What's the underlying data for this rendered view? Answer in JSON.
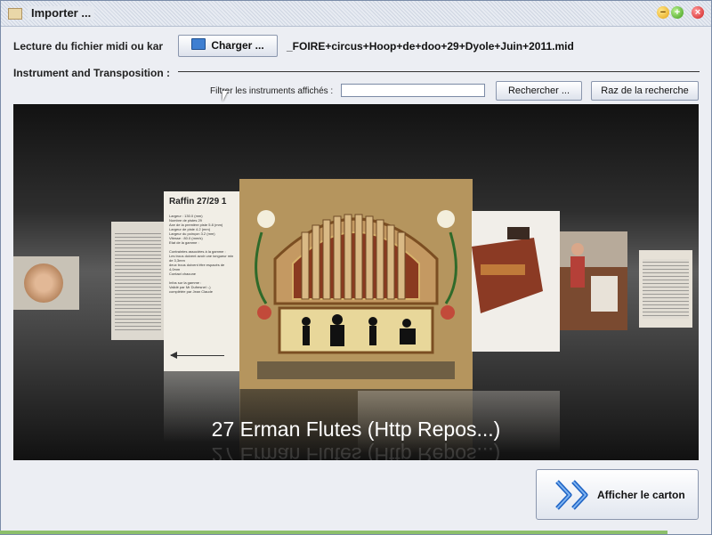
{
  "window": {
    "title": "Importer ..."
  },
  "file": {
    "label": "Lecture du fichier midi ou kar",
    "load_button": "Charger ...",
    "filename": "_FOIRE+circus+Hoop+de+doo+29+Dyole+Juin+2011.mid"
  },
  "section": {
    "label": "Instrument and Transposition :"
  },
  "filter": {
    "label": "Filtrer les instruments affichés :",
    "value": "",
    "search_button": "Rechercher ...",
    "reset_button": "Raz de la recherche"
  },
  "coverflow": {
    "selected_caption": "27 Erman Flutes (Http Repos...)",
    "raffin_card": {
      "title": "Raffin 27/29 1",
      "text": "Largeur : 130.0 (mm)\nNombre de pistes 29\nAxe de la première piste 5.8 (mm)\nLargeur de piste 4.2 (mm)\nLargeur du poinçon 3.2 (mm)\nVitesse : 80.0 (mm/s)\nEtat de la gamme :\n\nContraintes associées à la gamme :\nLes trous doivent avoir une longueur min de 3,3mm\ndeux trous doivent être espacés de 4,0mm\nContact chacune\n\nInfos sur la gamme :\nValidé par Mr Dufresnel :-)\ncomplétée par Jean Claude"
    }
  },
  "actions": {
    "show_button": "Afficher le carton"
  },
  "colors": {
    "accent": "#3f7fd1",
    "status": "#8cbf6b",
    "coverflow_bg": "#2e2e2e"
  }
}
